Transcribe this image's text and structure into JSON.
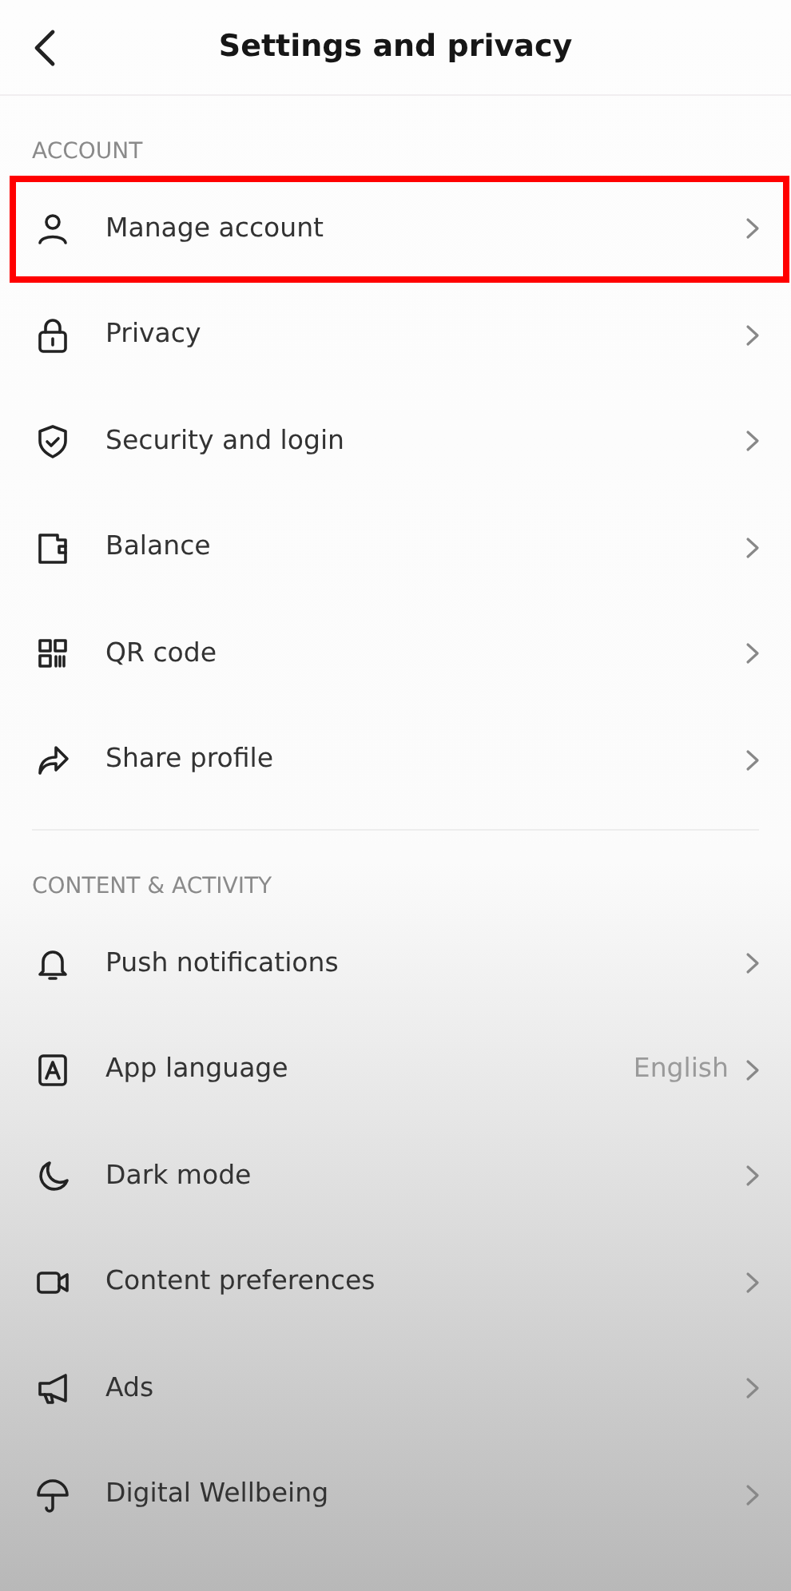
{
  "header": {
    "title": "Settings and privacy"
  },
  "sections": [
    {
      "title": "ACCOUNT",
      "items": [
        {
          "label": "Manage account",
          "highlighted": true
        },
        {
          "label": "Privacy",
          "highlighted": false
        },
        {
          "label": "Security and login",
          "highlighted": false
        },
        {
          "label": "Balance",
          "highlighted": false
        },
        {
          "label": "QR code",
          "highlighted": false
        },
        {
          "label": "Share profile",
          "highlighted": false
        }
      ]
    },
    {
      "title": "CONTENT & ACTIVITY",
      "items": [
        {
          "label": "Push notifications",
          "highlighted": false
        },
        {
          "label": "App language",
          "value": "English",
          "highlighted": false
        },
        {
          "label": "Dark mode",
          "highlighted": false
        },
        {
          "label": "Content preferences",
          "highlighted": false
        },
        {
          "label": "Ads",
          "highlighted": false
        },
        {
          "label": "Digital Wellbeing",
          "highlighted": false
        }
      ]
    }
  ]
}
